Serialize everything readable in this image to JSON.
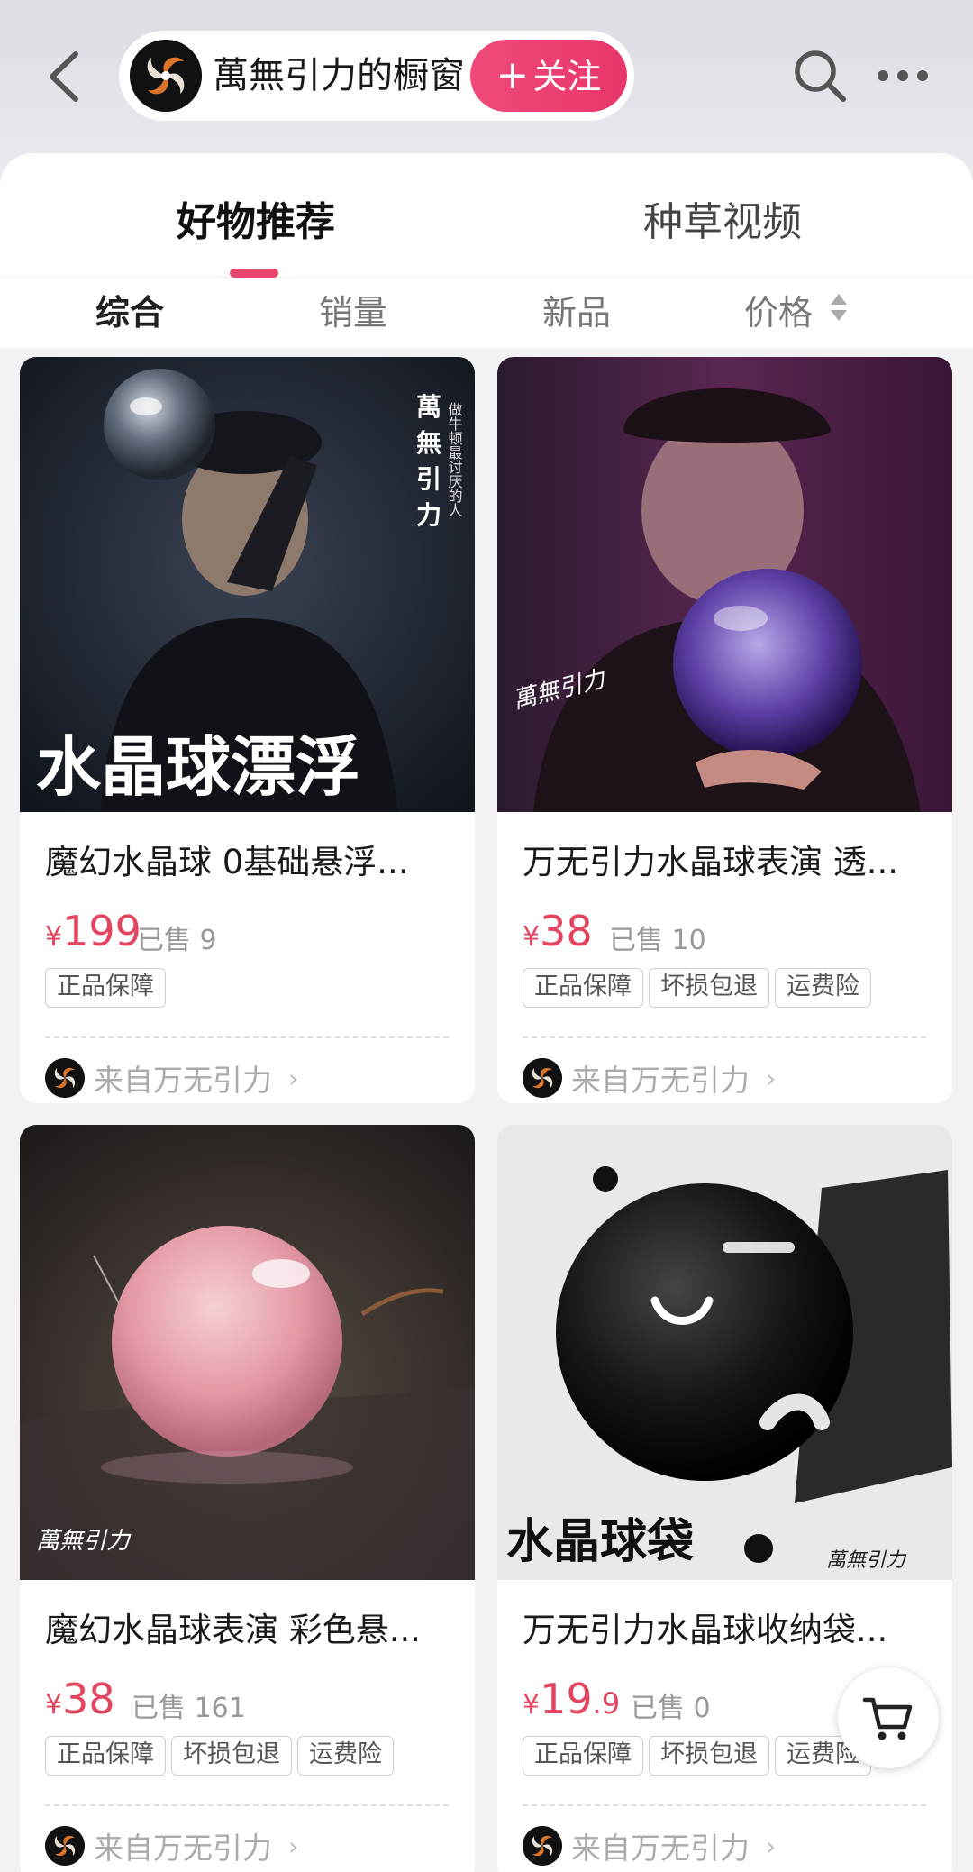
{
  "header": {
    "store_name": "萬無引力的橱窗",
    "follow_label": "关注",
    "follow_plus": "+"
  },
  "tabs": [
    {
      "label": "好物推荐",
      "active": true
    },
    {
      "label": "种草视频",
      "active": false
    }
  ],
  "sort_options": [
    {
      "label": "综合",
      "active": true
    },
    {
      "label": "销量",
      "active": false
    },
    {
      "label": "新品",
      "active": false
    },
    {
      "label": "价格",
      "active": false
    }
  ],
  "products": [
    {
      "title": "魔幻水晶球 0基础悬浮...",
      "price_symbol": "¥",
      "price_int": "199",
      "price_dec": "",
      "sold": "已售 9",
      "badges": [
        "正品保障"
      ],
      "from": "来自万无引力",
      "image_caption": "水晶球漂浮",
      "image_brand": "萬無引力",
      "image_slogan": "做牛顿最讨厌的人"
    },
    {
      "title": "万无引力水晶球表演 透...",
      "price_symbol": "¥",
      "price_int": "38",
      "price_dec": "",
      "sold": "已售 10",
      "badges": [
        "正品保障",
        "坏损包退",
        "运费险"
      ],
      "from": "来自万无引力",
      "image_brand": "萬無引力"
    },
    {
      "title": "魔幻水晶球表演 彩色悬...",
      "price_symbol": "¥",
      "price_int": "38",
      "price_dec": "",
      "sold": "已售 161",
      "badges": [
        "正品保障",
        "坏损包退",
        "运费险"
      ],
      "from": "来自万无引力",
      "image_brand": "萬無引力"
    },
    {
      "title": "万无引力水晶球收纳袋...",
      "price_symbol": "¥",
      "price_int": "19",
      "price_dec": ".9",
      "sold": "已售 0",
      "badges": [
        "正品保障",
        "坏损包退",
        "运费险"
      ],
      "from": "来自万无引力",
      "image_caption": "水晶球袋",
      "image_brand": "萬無引力"
    }
  ],
  "colors": {
    "accent": "#e8466f",
    "price": "#e3445f",
    "follow_bg": "#ec3f72"
  },
  "icons": [
    "back-arrow-icon",
    "search-icon",
    "more-icon",
    "cart-icon",
    "sort-arrows-icon"
  ]
}
